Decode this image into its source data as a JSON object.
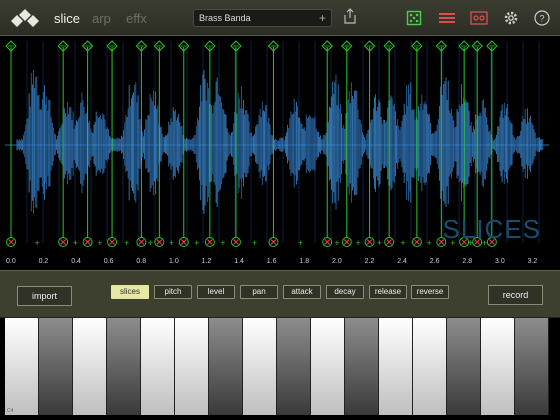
{
  "header": {
    "tabs": [
      {
        "label": "slice",
        "active": true
      },
      {
        "label": "arp",
        "active": false
      },
      {
        "label": "effx",
        "active": false
      }
    ],
    "preset_name": "Brass Banda",
    "preset_add": "+",
    "icons": [
      "logo-icon",
      "share-icon",
      "dice-icon",
      "list-icon",
      "tape-icon",
      "gear-icon",
      "help-icon"
    ],
    "accent_colors": {
      "dice": "#4ad04a",
      "list": "#d85050",
      "tape": "#d85050"
    }
  },
  "waveform": {
    "title": "SLICES",
    "color": "#3d8ad0",
    "marker_color": "#29c52a",
    "x_ticks": [
      "0.0",
      "0.2",
      "0.4",
      "0.6",
      "0.8",
      "1.0",
      "1.2",
      "1.4",
      "1.6",
      "1.8",
      "2.0",
      "2.2",
      "2.4",
      "2.6",
      "2.8",
      "3.0",
      "3.2"
    ],
    "slice_markers_seconds": [
      0.0,
      0.32,
      0.47,
      0.62,
      0.8,
      0.91,
      1.06,
      1.22,
      1.38,
      1.61,
      1.94,
      2.06,
      2.2,
      2.32,
      2.49,
      2.64,
      2.78,
      2.86,
      2.95
    ]
  },
  "controls": {
    "import_label": "import",
    "record_label": "record",
    "params": [
      {
        "label": "slices",
        "selected": true
      },
      {
        "label": "pitch",
        "selected": false
      },
      {
        "label": "level",
        "selected": false
      },
      {
        "label": "pan",
        "selected": false
      },
      {
        "label": "attack",
        "selected": false
      },
      {
        "label": "decay",
        "selected": false
      },
      {
        "label": "release",
        "selected": false
      },
      {
        "label": "reverse",
        "selected": false
      }
    ]
  },
  "keyboard": {
    "key_count": 16,
    "label": "C4"
  }
}
